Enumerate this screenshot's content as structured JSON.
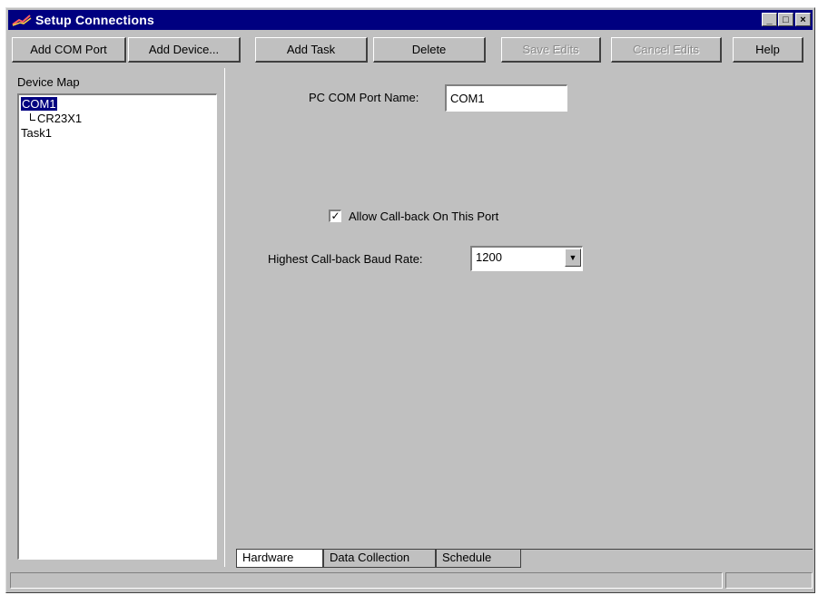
{
  "window": {
    "title": "Setup Connections",
    "minimize_glyph": "_",
    "maximize_glyph": "□",
    "close_glyph": "×"
  },
  "toolbar": {
    "buttons": [
      {
        "label": "Add COM Port",
        "enabled": true
      },
      {
        "label": "Add Device...",
        "enabled": true
      },
      {
        "label": "Add Task",
        "enabled": true
      },
      {
        "label": "Delete",
        "enabled": true
      },
      {
        "label": "Save Edits",
        "enabled": false
      },
      {
        "label": "Cancel Edits",
        "enabled": false
      },
      {
        "label": "Help",
        "enabled": true
      }
    ]
  },
  "device_map": {
    "label": "Device Map",
    "items": [
      {
        "label": "COM1",
        "selected": true,
        "level": 0
      },
      {
        "label": "CR23X1",
        "selected": false,
        "level": 1
      },
      {
        "label": "Task1",
        "selected": false,
        "level": 0
      }
    ]
  },
  "hardware": {
    "port_name_label": "PC COM Port Name:",
    "port_name_value": "COM1",
    "callback_label": "Allow Call-back On This Port",
    "callback_checked": true,
    "baud_label": "Highest Call-back Baud Rate:",
    "baud_value": "1200"
  },
  "tabs": [
    {
      "label": "Hardware",
      "active": true
    },
    {
      "label": "Data Collection",
      "active": false
    },
    {
      "label": "Schedule",
      "active": false
    }
  ],
  "status": {
    "left": "",
    "right": ""
  },
  "colors": {
    "titlebar": "#000080",
    "face": "#c0c0c0",
    "selection": "#000080"
  }
}
